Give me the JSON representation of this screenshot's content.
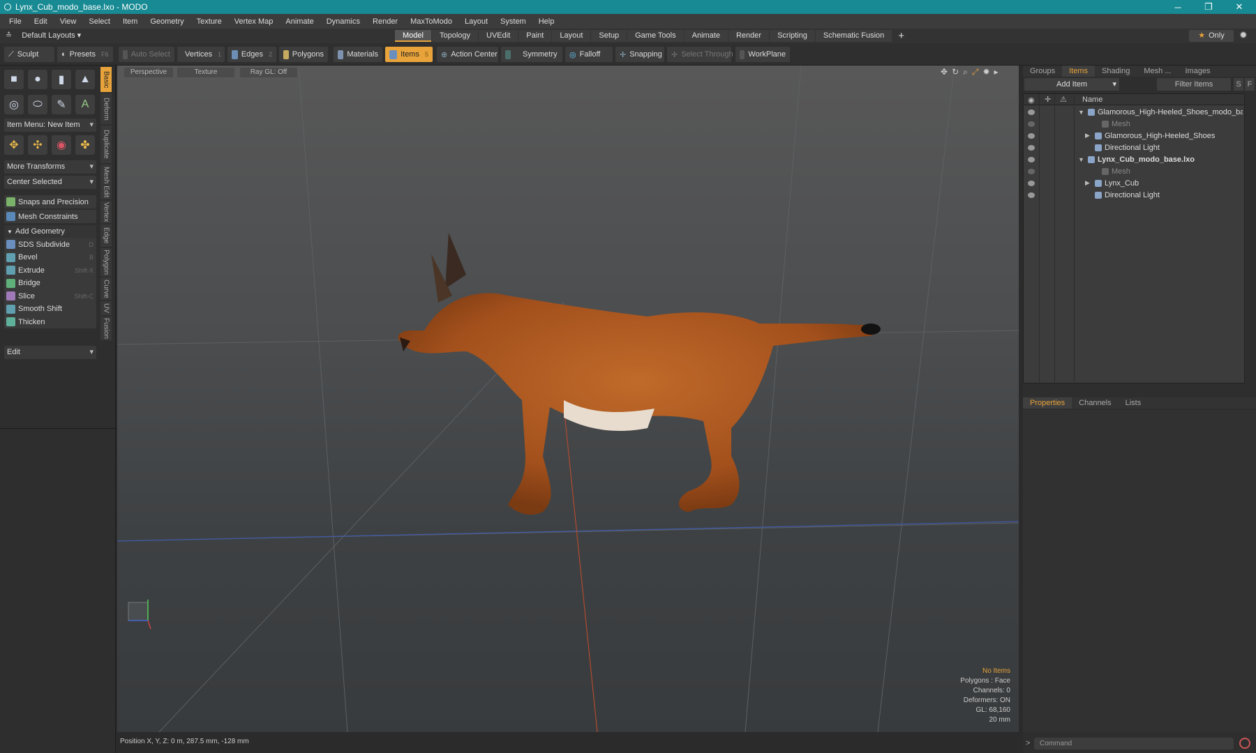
{
  "window": {
    "title": "Lynx_Cub_modo_base.lxo - MODO"
  },
  "menu": [
    "File",
    "Edit",
    "View",
    "Select",
    "Item",
    "Geometry",
    "Texture",
    "Vertex Map",
    "Animate",
    "Dynamics",
    "Render",
    "MaxToModo",
    "Layout",
    "System",
    "Help"
  ],
  "layouts": {
    "default_label": "Default Layouts",
    "tabs": [
      "Model",
      "Topology",
      "UVEdit",
      "Paint",
      "Layout",
      "Setup",
      "Game Tools",
      "Animate",
      "Render",
      "Scripting",
      "Schematic Fusion"
    ],
    "active_tab": "Model",
    "only_label": "Only"
  },
  "toolbar": {
    "sculpt": "Sculpt",
    "presets": "Presets",
    "presets_key": "F6",
    "auto_select": "Auto Select",
    "vertices": "Vertices",
    "vertices_key": "1",
    "edges": "Edges",
    "edges_key": "2",
    "polygons": "Polygons",
    "materials": "Materials",
    "items": "Items",
    "items_key": "5",
    "action_center": "Action Center",
    "symmetry": "Symmetry",
    "falloff": "Falloff",
    "snapping": "Snapping",
    "select_through": "Select Through",
    "workplane": "WorkPlane"
  },
  "left": {
    "item_menu": "Item Menu: New Item",
    "more_transforms": "More Transforms",
    "center_selected": "Center Selected",
    "snaps": "Snaps and Precision",
    "constraints": "Mesh Constraints",
    "add_geometry": "Add Geometry",
    "tools": [
      {
        "label": "SDS Subdivide",
        "key": "D",
        "color": "#6a8fbf"
      },
      {
        "label": "Bevel",
        "key": "B",
        "color": "#5f9fb0"
      },
      {
        "label": "Extrude",
        "key": "Shift-X",
        "color": "#5f9fb0"
      },
      {
        "label": "Bridge",
        "key": "",
        "color": "#5fb07a"
      },
      {
        "label": "Slice",
        "key": "Shift-C",
        "color": "#a07ab8"
      },
      {
        "label": "Smooth Shift",
        "key": "",
        "color": "#5f9fb0"
      },
      {
        "label": "Thicken",
        "key": "",
        "color": "#5fb09a"
      }
    ],
    "edit": "Edit",
    "vtabs": [
      "Basic",
      "Deform",
      "Duplicate",
      "Mesh Edit",
      "Vertex",
      "Edge",
      "Polygon",
      "Curve",
      "UV",
      "Fusion"
    ]
  },
  "viewport": {
    "perspective": "Perspective",
    "texture": "Texture",
    "raygl": "Ray GL: Off",
    "hud": {
      "no_items": "No Items",
      "polygons": "Polygons : Face",
      "channels": "Channels: 0",
      "deformers": "Deformers: ON",
      "gl": "GL: 68,160",
      "scale": "20 mm"
    }
  },
  "status": {
    "position": "Position X, Y, Z:  0 m, 287.5 mm, -128 mm"
  },
  "right": {
    "top_tabs": [
      "Groups",
      "Items",
      "Shading",
      "Mesh ...",
      "Images"
    ],
    "active_top": "Items",
    "add_item": "Add Item",
    "filter": "Filter Items",
    "name_header": "Name",
    "tree": [
      {
        "label": "Glamorous_High-Heeled_Shoes_modo_bas ...",
        "indent": 0,
        "bold": false,
        "dim": false,
        "arrow": "▼"
      },
      {
        "label": "Mesh",
        "indent": 2,
        "bold": false,
        "dim": true,
        "arrow": ""
      },
      {
        "label": "Glamorous_High-Heeled_Shoes",
        "indent": 1,
        "bold": false,
        "dim": false,
        "arrow": "▶"
      },
      {
        "label": "Directional Light",
        "indent": 1,
        "bold": false,
        "dim": false,
        "arrow": ""
      },
      {
        "label": "Lynx_Cub_modo_base.lxo",
        "indent": 0,
        "bold": true,
        "dim": false,
        "arrow": "▼"
      },
      {
        "label": "Mesh",
        "indent": 2,
        "bold": false,
        "dim": true,
        "arrow": ""
      },
      {
        "label": "Lynx_Cub",
        "indent": 1,
        "bold": false,
        "dim": false,
        "arrow": "▶"
      },
      {
        "label": "Directional Light",
        "indent": 1,
        "bold": false,
        "dim": false,
        "arrow": ""
      }
    ],
    "bottom_tabs": [
      "Properties",
      "Channels",
      "Lists"
    ],
    "active_bottom": "Properties",
    "command_placeholder": "Command"
  }
}
